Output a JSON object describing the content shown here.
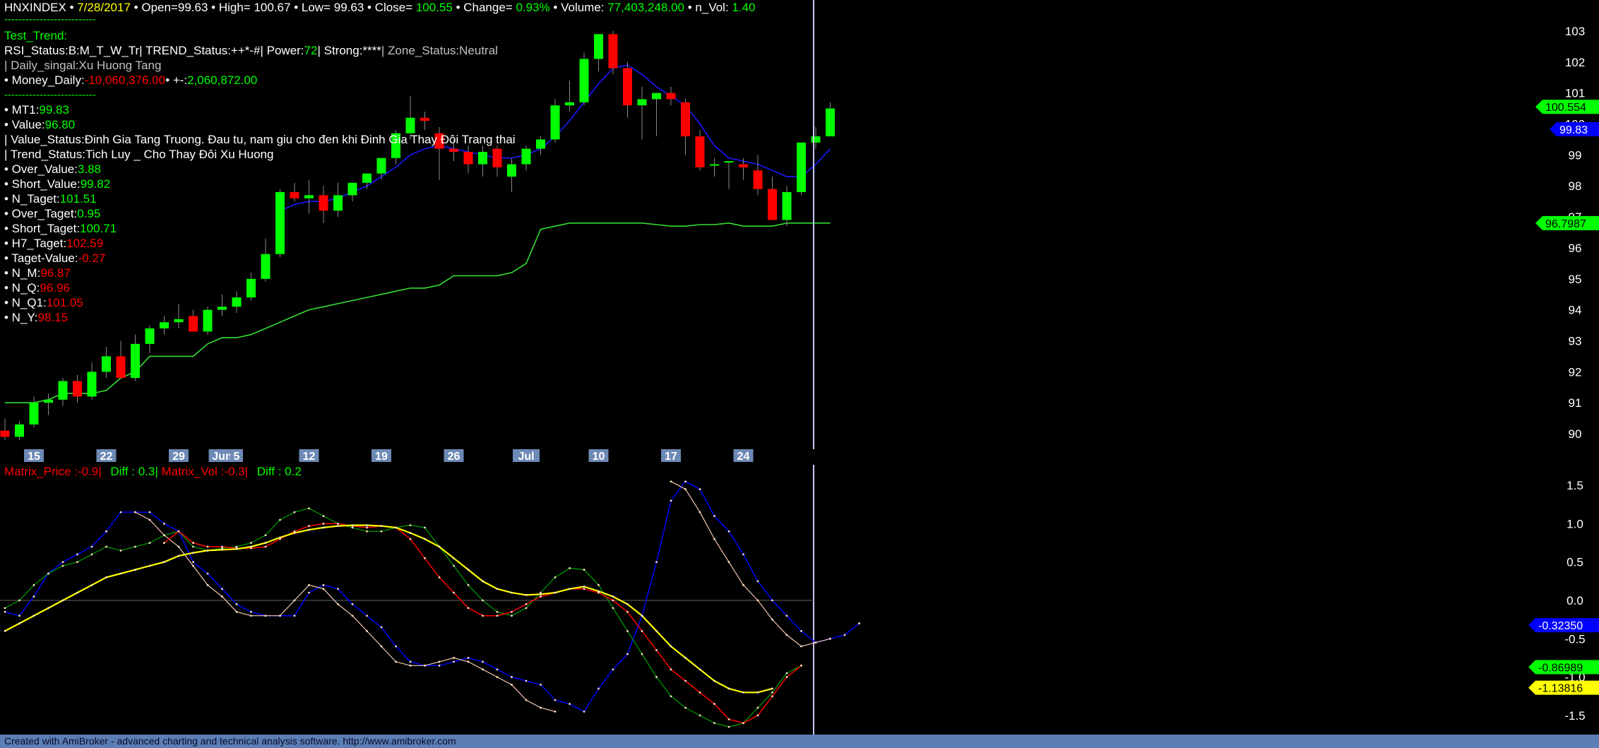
{
  "header": {
    "symbol": "HNXINDEX",
    "sep": "•",
    "date": "7/28/2017",
    "open_label": "Open=",
    "open": "99.63",
    "high_label": "High=",
    "high": "100.67",
    "low_label": "Low=",
    "low": "99.63",
    "close_label": "Close=",
    "close": "100.55",
    "change_label": "Change=",
    "change": "0.93%",
    "volume_label": "Volume:",
    "volume": "77,403,248.00",
    "nvol_label": "n_Vol:",
    "nvol": "1.40",
    "dashes": "--------------------------"
  },
  "info": {
    "test_trend": "Test_Trend:",
    "rsi_line_a": "RSI_Status:B:M_T_W_Tr| TREND_Status:++*-#| Power:",
    "power": "72",
    "rsi_line_b": "| Strong:****",
    "zone": "| Zone_Status:Neutral",
    "daily_singal": "| Daily_singal:Xu Huong Tang",
    "money_label": "• Money_Daily:",
    "money_value": "-10,060,376.00",
    "pm_label": "• +-:",
    "pm_value": "2,060,872.00",
    "dashes2": "--------------------------",
    "items": [
      {
        "label": "• MT1:",
        "value": "99.83",
        "color": "#00ff00"
      },
      {
        "label": "• Value:",
        "value": "96.80",
        "color": "#00ff00"
      },
      {
        "label": "| Value_Status:Đinh Gia Tang Truong. Đau tu, nam giu cho đen khi Đinh Gia Thay Đôi Trang thai",
        "value": "",
        "color": "#ffffff"
      },
      {
        "label": "| Trend_Status:Tich Luy _ Cho Thay Đôi Xu Huong",
        "value": "",
        "color": "#ffffff"
      },
      {
        "label": "• Over_Value:",
        "value": "3.88",
        "color": "#00ff00"
      },
      {
        "label": "• Short_Value:",
        "value": "99.82",
        "color": "#00ff00"
      },
      {
        "label": "• N_Taget:",
        "value": "101.51",
        "color": "#00ff00"
      },
      {
        "label": "• Over_Taget:",
        "value": "0.95",
        "color": "#00ff00"
      },
      {
        "label": "• Short_Taget:",
        "value": "100.71",
        "color": "#00ff00"
      },
      {
        "label": "• H7_Taget:",
        "value": "102.59",
        "color": "#ff0000"
      },
      {
        "label": "• Taget-Value:",
        "value": "-0.27",
        "color": "#ff0000"
      },
      {
        "label": "• N_M:",
        "value": "96.87",
        "color": "#ff0000"
      },
      {
        "label": "• N_Q:",
        "value": "96.96",
        "color": "#ff0000"
      },
      {
        "label": "• N_Q1:",
        "value": "101.05",
        "color": "#ff0000"
      },
      {
        "label": "• N_Y:",
        "value": "98.15",
        "color": "#ff0000"
      }
    ]
  },
  "matrix": {
    "price_label": "Matrix_Price :-0.9|",
    "diff1": "Diff : 0.3|",
    "vol_label": "Matrix_Vol :-0.3|",
    "diff2": "Diff : 0.2"
  },
  "footer": "Created with AmiBroker - advanced charting and technical analysis software. http://www.amibroker.com",
  "colors": {
    "up": "#00ff00",
    "down": "#ff0000",
    "blue": "#0000ff",
    "yellow": "#ffff00",
    "axis_label_bg": "#6d89b5"
  },
  "chart_data": [
    {
      "type": "candlestick",
      "title": "HNXINDEX",
      "ylim": [
        89.5,
        103.5
      ],
      "yticks": [
        103,
        102,
        101,
        100,
        99,
        98,
        97,
        96,
        95,
        94,
        93,
        92,
        91,
        90
      ],
      "x_labels": [
        {
          "index": 2,
          "text": "15"
        },
        {
          "index": 7,
          "text": "22"
        },
        {
          "index": 12,
          "text": "29"
        },
        {
          "index": 15,
          "text": "Jun"
        },
        {
          "index": 16,
          "text": "5"
        },
        {
          "index": 21,
          "text": "12"
        },
        {
          "index": 26,
          "text": "19"
        },
        {
          "index": 31,
          "text": "26"
        },
        {
          "index": 36,
          "text": "Jul"
        },
        {
          "index": 41,
          "text": "10"
        },
        {
          "index": 46,
          "text": "17"
        },
        {
          "index": 51,
          "text": "24"
        }
      ],
      "candles": [
        [
          90.1,
          90.5,
          89.8,
          89.9
        ],
        [
          89.9,
          90.4,
          89.8,
          90.3
        ],
        [
          90.3,
          91.2,
          90.2,
          91.0
        ],
        [
          91.0,
          91.3,
          90.6,
          91.1
        ],
        [
          91.1,
          91.8,
          90.9,
          91.7
        ],
        [
          91.7,
          91.9,
          91.0,
          91.2
        ],
        [
          91.2,
          92.3,
          91.1,
          92.0
        ],
        [
          92.0,
          92.8,
          91.8,
          92.5
        ],
        [
          92.5,
          93.0,
          91.9,
          91.8
        ],
        [
          91.8,
          93.2,
          91.7,
          92.9
        ],
        [
          92.9,
          93.5,
          92.6,
          93.4
        ],
        [
          93.4,
          93.8,
          93.2,
          93.6
        ],
        [
          93.6,
          94.2,
          93.4,
          93.7
        ],
        [
          93.8,
          94.0,
          93.3,
          93.3
        ],
        [
          93.3,
          94.1,
          93.2,
          94.0
        ],
        [
          94.0,
          94.5,
          93.8,
          94.1
        ],
        [
          94.1,
          94.6,
          93.9,
          94.4
        ],
        [
          94.4,
          95.2,
          94.3,
          95.0
        ],
        [
          95.0,
          96.3,
          94.9,
          95.8
        ],
        [
          95.8,
          97.9,
          95.7,
          97.8
        ],
        [
          97.8,
          98.1,
          97.5,
          97.6
        ],
        [
          97.6,
          98.2,
          97.1,
          97.7
        ],
        [
          97.7,
          98.0,
          96.8,
          97.2
        ],
        [
          97.2,
          98.1,
          97.0,
          97.7
        ],
        [
          97.7,
          98.1,
          97.5,
          98.1
        ],
        [
          98.1,
          98.4,
          97.9,
          98.4
        ],
        [
          98.4,
          98.9,
          98.2,
          98.9
        ],
        [
          98.9,
          99.8,
          98.7,
          99.7
        ],
        [
          99.7,
          100.9,
          99.5,
          100.2
        ],
        [
          100.2,
          100.4,
          99.8,
          100.1
        ],
        [
          99.7,
          99.9,
          98.2,
          99.2
        ],
        [
          99.2,
          99.5,
          98.8,
          99.1
        ],
        [
          99.1,
          99.3,
          98.4,
          98.7
        ],
        [
          98.7,
          99.3,
          98.3,
          99.1
        ],
        [
          99.2,
          99.3,
          98.3,
          98.6
        ],
        [
          98.3,
          98.9,
          97.8,
          98.7
        ],
        [
          98.7,
          99.3,
          98.5,
          99.2
        ],
        [
          99.2,
          99.6,
          99.0,
          99.5
        ],
        [
          99.5,
          100.8,
          99.4,
          100.6
        ],
        [
          100.6,
          101.4,
          100.4,
          100.7
        ],
        [
          100.7,
          102.3,
          100.6,
          102.1
        ],
        [
          102.1,
          102.9,
          101.7,
          102.9
        ],
        [
          102.9,
          103.0,
          101.6,
          101.8
        ],
        [
          101.8,
          102.0,
          100.2,
          100.6
        ],
        [
          100.6,
          101.2,
          99.5,
          100.8
        ],
        [
          100.8,
          101.0,
          99.6,
          101.0
        ],
        [
          101.0,
          101.2,
          100.6,
          100.8
        ],
        [
          100.7,
          100.8,
          99.0,
          99.6
        ],
        [
          99.6,
          99.8,
          98.5,
          98.6
        ],
        [
          98.7,
          98.9,
          98.3,
          98.7
        ],
        [
          98.8,
          98.8,
          97.9,
          98.8
        ],
        [
          98.7,
          98.9,
          98.2,
          98.6
        ],
        [
          98.5,
          99.0,
          97.7,
          97.9
        ],
        [
          97.9,
          98.3,
          97.1,
          96.9
        ],
        [
          96.9,
          98.0,
          96.7,
          97.8
        ],
        [
          97.8,
          99.4,
          97.7,
          99.4
        ],
        [
          99.4,
          99.9,
          99.2,
          99.6
        ],
        [
          99.6,
          100.7,
          99.6,
          100.5
        ]
      ],
      "ma_blue": [
        null,
        null,
        null,
        null,
        null,
        null,
        null,
        null,
        null,
        null,
        null,
        null,
        null,
        null,
        null,
        null,
        null,
        null,
        null,
        97.2,
        97.4,
        97.5,
        97.5,
        97.6,
        97.8,
        98.0,
        98.3,
        98.6,
        99.0,
        99.2,
        99.3,
        99.2,
        99.1,
        99.0,
        98.9,
        98.9,
        99.0,
        99.2,
        99.6,
        100.1,
        100.7,
        101.3,
        101.8,
        101.9,
        101.6,
        101.2,
        100.9,
        100.6,
        100.0,
        99.3,
        98.9,
        98.8,
        98.7,
        98.5,
        98.3,
        98.3,
        98.7,
        99.2
      ],
      "ma_green": [
        91.0,
        91.0,
        91.0,
        91.1,
        91.3,
        91.3,
        91.3,
        91.4,
        91.8,
        92.0,
        92.5,
        92.5,
        92.5,
        92.5,
        92.9,
        93.1,
        93.1,
        93.2,
        93.4,
        93.6,
        93.8,
        94.0,
        94.1,
        94.2,
        94.3,
        94.4,
        94.5,
        94.6,
        94.7,
        94.7,
        94.8,
        95.1,
        95.1,
        95.1,
        95.1,
        95.2,
        95.5,
        96.6,
        96.7,
        96.8,
        96.8,
        96.8,
        96.8,
        96.8,
        96.8,
        96.75,
        96.7,
        96.7,
        96.75,
        96.75,
        96.8,
        96.7,
        96.7,
        96.7,
        96.8,
        96.8,
        96.8,
        96.8
      ],
      "markers": [
        {
          "text": "100.554",
          "value": 100.554,
          "bg": "#00ff00",
          "fg": "#000000"
        },
        {
          "text": "99.83",
          "value": 99.83,
          "bg": "#0000ff",
          "fg": "#ffffff"
        },
        {
          "text": "96.7987",
          "value": 96.7987,
          "bg": "#00ff00",
          "fg": "#000000"
        }
      ]
    },
    {
      "type": "line",
      "ylim": [
        -1.75,
        1.75
      ],
      "yticks": [
        1.5,
        1.0,
        0.5,
        0.0,
        -0.5,
        -1.0,
        -1.5
      ],
      "zero_line": 0,
      "series": [
        {
          "color": "#0000ff",
          "values": [
            -0.15,
            -0.2,
            0.05,
            0.35,
            0.5,
            0.6,
            0.7,
            0.9,
            1.15,
            1.15,
            1.15,
            1.0,
            0.9,
            0.5,
            0.35,
            0.15,
            -0.05,
            -0.15,
            -0.2,
            -0.2,
            -0.2,
            0.1,
            0.2,
            0.15,
            -0.05,
            -0.2,
            -0.35,
            -0.6,
            -0.8,
            -0.85,
            -0.85,
            -0.8,
            -0.75,
            -0.8,
            -0.9,
            -1.0,
            -1.05,
            -1.1,
            -1.3,
            -1.35,
            -1.45,
            -1.15,
            -0.9,
            -0.7,
            -0.2,
            0.5,
            1.3,
            1.55,
            1.45,
            1.1,
            0.9,
            0.6,
            0.25,
            0.0,
            -0.2,
            -0.4,
            -0.55,
            -0.5,
            -0.45,
            -0.3
          ]
        },
        {
          "color": "#f5c8b0",
          "values": [
            null,
            null,
            null,
            null,
            null,
            null,
            null,
            null,
            null,
            1.15,
            1.05,
            0.85,
            0.7,
            0.45,
            0.2,
            0.05,
            -0.15,
            -0.2,
            -0.2,
            -0.2,
            0.0,
            0.2,
            0.15,
            -0.05,
            -0.2,
            -0.4,
            -0.6,
            -0.8,
            -0.85,
            -0.85,
            -0.8,
            -0.75,
            -0.8,
            -0.9,
            -1.0,
            -1.1,
            -1.3,
            -1.4,
            -1.45,
            null,
            null,
            null,
            null,
            null,
            null,
            null,
            1.55,
            1.45,
            1.15,
            0.8,
            0.5,
            0.2,
            0.0,
            -0.25,
            -0.45,
            -0.6,
            -0.55,
            -0.5
          ]
        },
        {
          "color": "#00a000",
          "values": [
            -0.1,
            0.0,
            0.2,
            0.35,
            0.45,
            0.5,
            0.6,
            0.7,
            0.65,
            0.7,
            0.75,
            0.85,
            0.9,
            0.7,
            0.65,
            0.68,
            0.7,
            0.75,
            0.85,
            1.05,
            1.15,
            1.2,
            1.1,
            1.0,
            0.95,
            0.9,
            0.9,
            0.95,
            0.98,
            0.95,
            0.7,
            0.45,
            0.2,
            0.0,
            -0.15,
            -0.2,
            -0.1,
            0.1,
            0.3,
            0.42,
            0.4,
            0.2,
            -0.1,
            -0.4,
            -0.7,
            -1.0,
            -1.25,
            -1.4,
            -1.5,
            -1.6,
            -1.65,
            -1.6,
            -1.4,
            -1.2,
            -0.95,
            -0.85
          ]
        },
        {
          "color": "#ff0000",
          "values": [
            null,
            null,
            null,
            null,
            null,
            null,
            null,
            null,
            null,
            null,
            null,
            0.75,
            0.9,
            0.75,
            0.7,
            0.7,
            0.68,
            0.68,
            0.7,
            0.8,
            0.9,
            0.97,
            1.0,
            1.0,
            0.97,
            0.95,
            0.97,
            0.95,
            0.8,
            0.55,
            0.3,
            0.1,
            -0.1,
            -0.2,
            -0.2,
            -0.15,
            -0.05,
            0.05,
            0.1,
            0.15,
            0.15,
            0.1,
            0.0,
            -0.15,
            -0.4,
            -0.65,
            -0.9,
            -1.05,
            -1.2,
            -1.35,
            -1.55,
            -1.6,
            -1.5,
            -1.25,
            -1.0,
            -0.85
          ]
        },
        {
          "color": "#ffff00",
          "values": [
            -0.4,
            -0.3,
            -0.2,
            -0.1,
            0.0,
            0.1,
            0.2,
            0.3,
            0.35,
            0.4,
            0.45,
            0.5,
            0.58,
            0.62,
            0.65,
            0.66,
            0.67,
            0.7,
            0.75,
            0.82,
            0.88,
            0.92,
            0.95,
            0.97,
            0.98,
            0.98,
            0.97,
            0.95,
            0.88,
            0.8,
            0.7,
            0.55,
            0.4,
            0.25,
            0.15,
            0.1,
            0.07,
            0.08,
            0.1,
            0.15,
            0.18,
            0.12,
            0.05,
            -0.05,
            -0.2,
            -0.4,
            -0.6,
            -0.75,
            -0.9,
            -1.05,
            -1.15,
            -1.2,
            -1.2,
            -1.15
          ]
        }
      ],
      "markers": [
        {
          "text": "-0.32350",
          "value": -0.3235,
          "bg": "#0000ff",
          "fg": "#ffffff"
        },
        {
          "text": "-0.86989",
          "value": -0.86989,
          "bg": "#00ff00",
          "fg": "#000000"
        },
        {
          "text": "-1.13816",
          "value": -1.13816,
          "bg": "#ffff00",
          "fg": "#000000"
        }
      ]
    }
  ]
}
